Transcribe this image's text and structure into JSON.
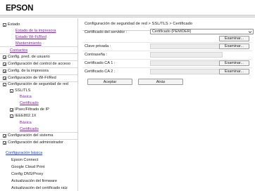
{
  "brand": "EPSON",
  "sidebar": {
    "items": [
      {
        "label": "Estado",
        "type": "box-open"
      },
      {
        "label": "Estado de la impresora",
        "type": "link"
      },
      {
        "label": "Estado Wi-Fi/Red",
        "type": "link"
      },
      {
        "label": "Mantenimiento",
        "type": "link"
      },
      {
        "label": "Contactos",
        "type": "link"
      },
      {
        "label": "Config. pred. de usuario",
        "type": "box-closed"
      },
      {
        "label": "Configuración del control de acceso",
        "type": "box-closed"
      },
      {
        "label": "Config. de la impresora",
        "type": "box-closed"
      },
      {
        "label": "Configuración de Wi-Fi/Red",
        "type": "box-closed"
      },
      {
        "label": "Configuración de seguridad de red",
        "type": "box-open"
      },
      {
        "label": "SSL/TLS",
        "type": "box-open"
      },
      {
        "label": "Básica",
        "type": "link-plain"
      },
      {
        "label": "Certificado",
        "type": "link"
      },
      {
        "label": "IPsec/Filtrado de IP",
        "type": "box-closed"
      },
      {
        "label": "IEEE802.1X",
        "type": "box-open"
      },
      {
        "label": "Básica",
        "type": "link-plain"
      },
      {
        "label": "Certificado",
        "type": "link"
      },
      {
        "label": "Configuración del sistema",
        "type": "box-closed"
      },
      {
        "label": "Configuración del administrador",
        "type": "box-closed"
      }
    ],
    "basic_section": {
      "title": "Configuración básica",
      "items": [
        "Epson Connect",
        "Google Cloud Print",
        "Config DNS/Proxy",
        "Actualización del firmware",
        "Actualización del certificado raíz"
      ]
    }
  },
  "main": {
    "breadcrumb": "Configuración de seguridad de red > SSL/TLS > Certificado",
    "form": {
      "server_cert": {
        "label": "Certificado del servidor :",
        "value": "Certificado (PEM/DER)"
      },
      "server_cert_browse": "Examinar...",
      "private_key": {
        "label": "Clave privada :",
        "browse": "Examinar..."
      },
      "password": {
        "label": "Contraseña :"
      },
      "ca1": {
        "label": "Certificado CA 1 :",
        "browse": "Examinar..."
      },
      "ca2": {
        "label": "Certificado CA 2 :",
        "browse": "Examinar..."
      }
    },
    "accept_label": "Aceptar",
    "back_label": "Atrás"
  },
  "colors": {
    "link": "#8a1bb0",
    "section_link": "#1d3fc7",
    "field_bg": "#ececec"
  }
}
